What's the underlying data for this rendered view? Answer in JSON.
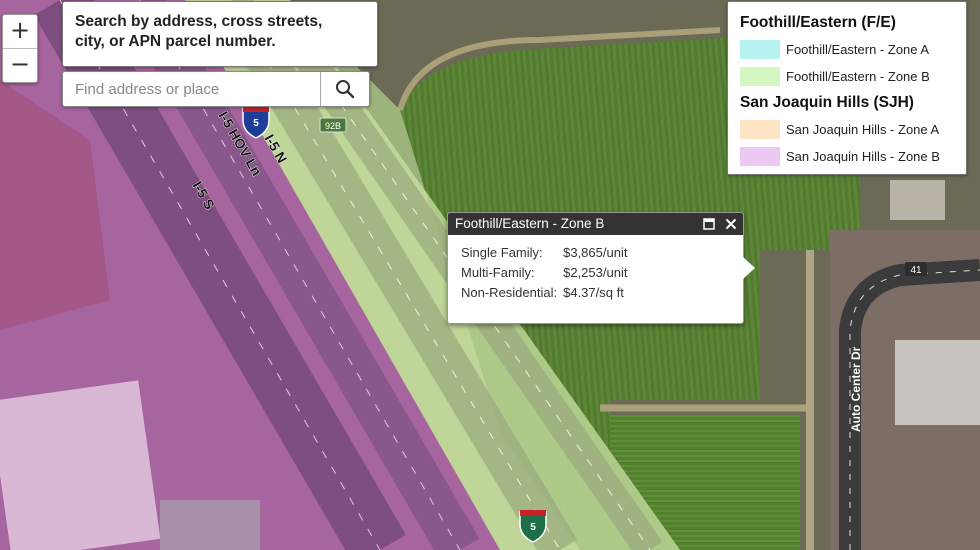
{
  "zoom": {
    "in_label": "+",
    "out_label": "−"
  },
  "search": {
    "help_text_line1": "Search by address, cross streets,",
    "help_text_line2": "city, or APN parcel number.",
    "placeholder": "Find address or place",
    "value": "",
    "icon": "search-icon"
  },
  "legend": {
    "groups": [
      {
        "title": "Foothill/Eastern (F/E)",
        "items": [
          {
            "label": "Foothill/Eastern - Zone A",
            "color": "#b6f2ef"
          },
          {
            "label": "Foothill/Eastern - Zone B",
            "color": "#d4f7c2"
          }
        ]
      },
      {
        "title": "San Joaquin Hills (SJH)",
        "items": [
          {
            "label": "San Joaquin Hills - Zone A",
            "color": "#fde4c4"
          },
          {
            "label": "San Joaquin Hills - Zone B",
            "color": "#ecc9f3"
          }
        ]
      }
    ]
  },
  "popup": {
    "title": "Foothill/Eastern - Zone B",
    "rows": [
      {
        "label": "Single Family:",
        "value": "$3,865/unit"
      },
      {
        "label": "Multi-Family:",
        "value": "$2,253/unit"
      },
      {
        "label": "Non-Residential:",
        "value": "$4.37/sq ft"
      }
    ]
  },
  "map_labels": {
    "i5s": "I-5 S",
    "hov": "I-5 HOV Ln",
    "i5n": "I-5 N",
    "shield": "5",
    "exit": "92B",
    "route41": "41",
    "auto_center": "Auto Center Dr"
  },
  "colors": {
    "zone_b_fe": "#d4f7c2",
    "zone_b_sjh": "#ecc9f3"
  }
}
